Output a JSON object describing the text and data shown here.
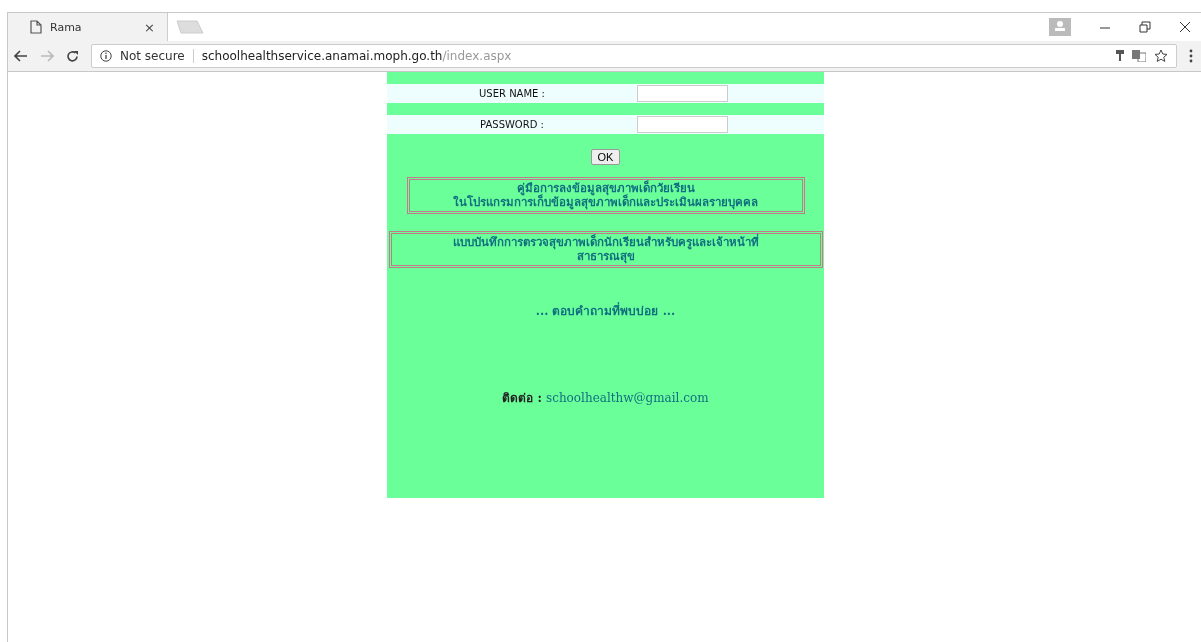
{
  "browser": {
    "tab": {
      "title": "Rama",
      "close": "×"
    },
    "security": "Not secure",
    "url_host": "schoolhealthservice.anamai.moph.go.th",
    "url_path": "/index.aspx"
  },
  "login": {
    "fields": [
      {
        "label": "USER NAME :"
      },
      {
        "label": "PASSWORD :"
      }
    ],
    "button": "OK"
  },
  "links": [
    {
      "text": "คู่มือการลงข้อมูลสุขภาพเด็กวัยเรียน\nในโปรแกรมการเก็บข้อมูลสุขภาพเด็กและประเมินผลรายบุคคล",
      "kind": "narrow"
    },
    {
      "text": "แบบบันทึกการตรวจสุขภาพเด็กนักเรียนสำหรับครูและเจ้าหน้าที่\nสาธารณสุข",
      "kind": "wide"
    }
  ],
  "faq": "... ตอบคำถามที่พบบ่อย ...",
  "contact": {
    "label": "ติดต่อ :",
    "email": "schoolhealthw@gmail.com"
  }
}
